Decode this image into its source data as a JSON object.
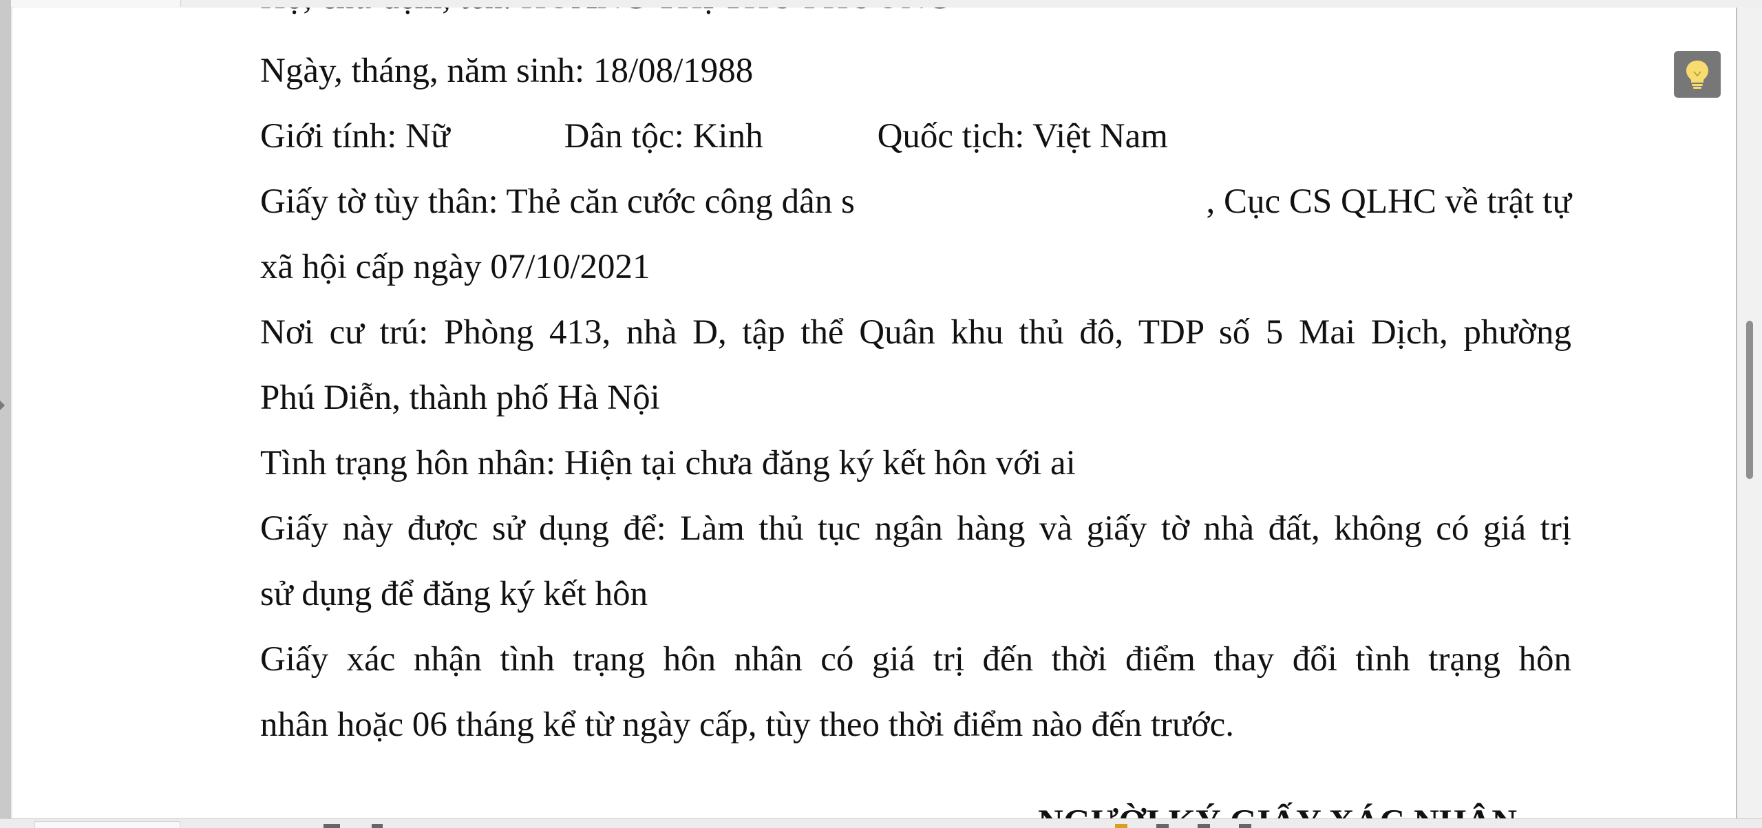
{
  "document": {
    "cut_top_line": "Họ, chữ đệm, tên: HOÀNG THỊ THU PHƯƠNG",
    "birth_date": "Ngày, tháng, năm sinh: 18/08/1988",
    "gender": "Giới tính: Nữ",
    "ethnicity": "Dân tộc: Kinh",
    "nationality": "Quốc tịch: Việt Nam",
    "id_doc_start": "Giấy tờ tùy thân: Thẻ căn cước công dân s",
    "id_doc_after_redaction": ", Cục CS QLHC về trật tự",
    "id_doc_line2": "xã hội cấp ngày 07/10/2021",
    "residence_line1": "Nơi cư trú: Phòng 413, nhà D, tập thể Quân khu thủ đô, TDP số 5 Mai Dịch, phường",
    "residence_line2": "Phú Diễn, thành phố Hà Nội",
    "marital_status": "Tình trạng hôn nhân: Hiện tại chưa đăng ký kết hôn với ai",
    "purpose_line1": "Giấy này được sử dụng để: Làm thủ tục ngân hàng và giấy tờ nhà đất, không có giá trị",
    "purpose_line2": "sử dụng để đăng ký kết hôn",
    "validity_line1": "Giấy xác nhận tình trạng hôn nhân có giá trị đến thời điểm thay đổi tình trạng hôn",
    "validity_line2": "nhân hoặc 06 tháng kể từ ngày cấp, tùy theo thời điểm nào đến trước.",
    "signer_heading": "NGƯỜI KÝ GIẤY XÁC NHẬN"
  },
  "icons": {
    "tip_button": "lightbulb-icon"
  },
  "colors": {
    "tip_button_bg": "#777777",
    "bulb": "#f7dc6f",
    "scroll_thumb": "#8f8f8f"
  }
}
